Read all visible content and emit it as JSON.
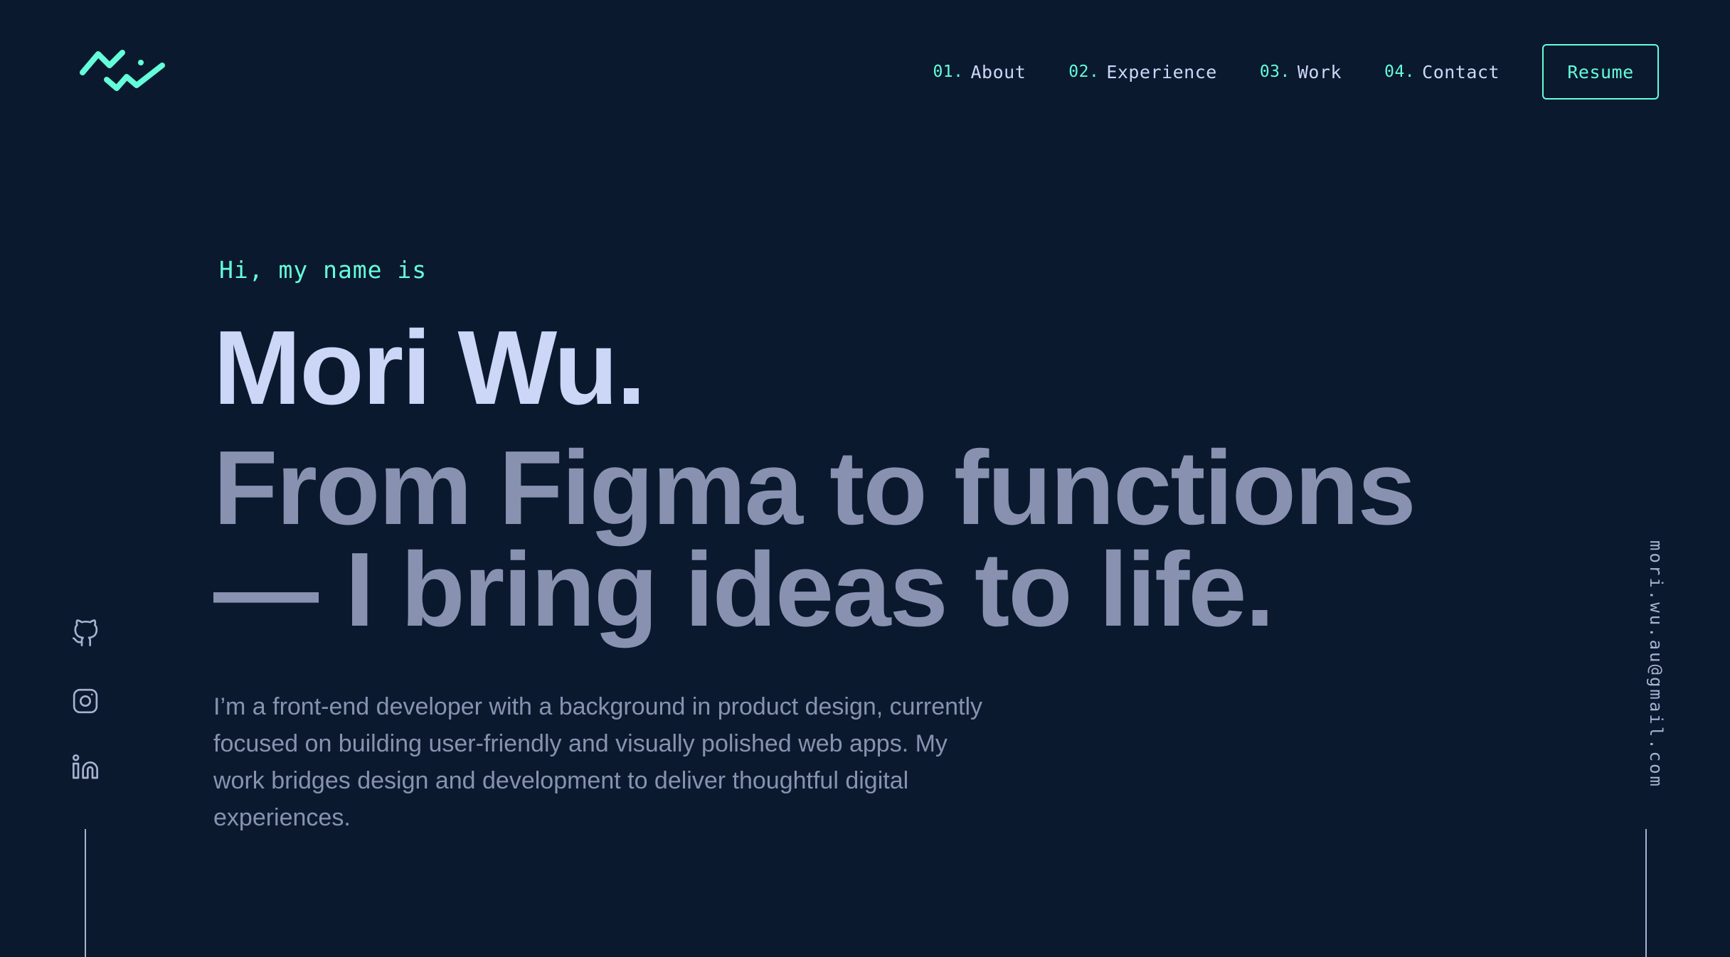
{
  "header": {
    "logo_icon": "zigzag-wave-logo",
    "nav": [
      {
        "num": "01.",
        "label": "About"
      },
      {
        "num": "02.",
        "label": "Experience"
      },
      {
        "num": "03.",
        "label": "Work"
      },
      {
        "num": "04.",
        "label": "Contact"
      }
    ],
    "resume_label": "Resume"
  },
  "hero": {
    "greeting": "Hi, my name is",
    "name": "Mori Wu.",
    "tagline_line1": "From Figma to functions",
    "tagline_line2": "— I bring ideas to life.",
    "bio": "I’m a front-end developer with a background in product design, currently focused on building user-friendly and visually polished web apps. My work bridges design and development to deliver thoughtful digital experiences."
  },
  "socials": [
    {
      "icon": "github-icon"
    },
    {
      "icon": "instagram-icon"
    },
    {
      "icon": "linkedin-icon"
    }
  ],
  "email": "mori.wu.au@gmail.com",
  "colors": {
    "background": "#0b192f",
    "accent": "#64ffda",
    "heading": "#ccd6f6",
    "body_text": "#8892b0"
  }
}
